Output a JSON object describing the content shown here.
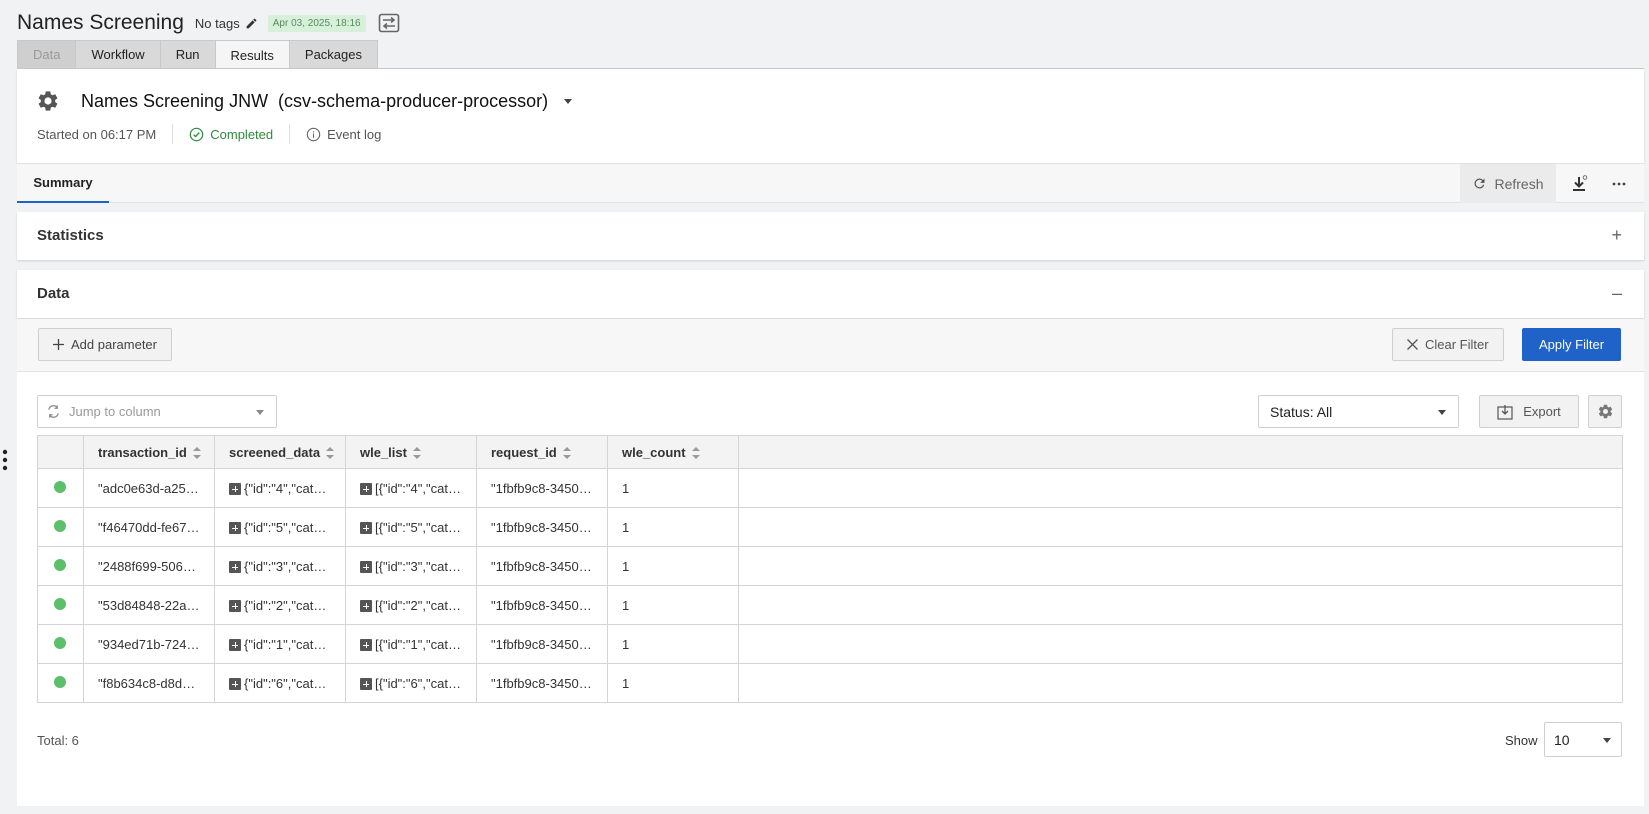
{
  "header": {
    "title": "Names Screening",
    "tags_label": "No tags",
    "date": "Apr 03, 2025, 18:16"
  },
  "tabs": [
    {
      "label": "Data"
    },
    {
      "label": "Workflow"
    },
    {
      "label": "Run"
    },
    {
      "label": "Results"
    },
    {
      "label": "Packages"
    }
  ],
  "job": {
    "title": "Names Screening JNW  (csv-schema-producer-processor)",
    "started": "Started on 06:17 PM",
    "status": "Completed",
    "event_log": "Event log"
  },
  "summary_bar": {
    "tab": "Summary",
    "refresh": "Refresh"
  },
  "sections": {
    "statistics": "Statistics",
    "statistics_toggle": "+",
    "data": "Data",
    "data_toggle": "–"
  },
  "filter": {
    "add_parameter": "Add parameter",
    "clear_filter": "Clear Filter",
    "apply_filter": "Apply Filter"
  },
  "toolbar": {
    "jump_placeholder": "Jump to column",
    "status_select": "Status: All",
    "export": "Export"
  },
  "table": {
    "columns": [
      "transaction_id",
      "screened_data",
      "wle_list",
      "request_id",
      "wle_count"
    ],
    "rows": [
      {
        "transaction_id": "\"adc0e63d-a25…",
        "screened_data": "{\"id\":\"4\",\"cat…",
        "wle_list": "[{\"id\":\"4\",\"cat…",
        "request_id": "\"1fbfb9c8-3450…",
        "wle_count": "1"
      },
      {
        "transaction_id": "\"f46470dd-fe67…",
        "screened_data": "{\"id\":\"5\",\"cat…",
        "wle_list": "[{\"id\":\"5\",\"cat…",
        "request_id": "\"1fbfb9c8-3450…",
        "wle_count": "1"
      },
      {
        "transaction_id": "\"2488f699-506…",
        "screened_data": "{\"id\":\"3\",\"cat…",
        "wle_list": "[{\"id\":\"3\",\"cat…",
        "request_id": "\"1fbfb9c8-3450…",
        "wle_count": "1"
      },
      {
        "transaction_id": "\"53d84848-22a…",
        "screened_data": "{\"id\":\"2\",\"cat…",
        "wle_list": "[{\"id\":\"2\",\"cat…",
        "request_id": "\"1fbfb9c8-3450…",
        "wle_count": "1"
      },
      {
        "transaction_id": "\"934ed71b-724…",
        "screened_data": "{\"id\":\"1\",\"cat…",
        "wle_list": "[{\"id\":\"1\",\"cat…",
        "request_id": "\"1fbfb9c8-3450…",
        "wle_count": "1"
      },
      {
        "transaction_id": "\"f8b634c8-d8d…",
        "screened_data": "{\"id\":\"6\",\"cat…",
        "wle_list": "[{\"id\":\"6\",\"cat…",
        "request_id": "\"1fbfb9c8-3450…",
        "wle_count": "1"
      }
    ]
  },
  "footer": {
    "total": "Total: 6",
    "show_label": "Show",
    "show_value": "10"
  },
  "colors": {
    "accent": "#1f62c8",
    "status_ok": "#5cbf6a",
    "completed_text": "#2e8b3d",
    "date_badge_bg": "#d7f0da"
  },
  "icons": {
    "pencil": "pencil-icon",
    "flow": "workflow-switch-icon",
    "settings": "gear-icon",
    "completed": "check-circle-icon",
    "info": "info-icon",
    "refresh": "refresh-icon",
    "download": "download-icon",
    "more": "more-horizontal-icon",
    "export": "export-icon",
    "expand": "plus-square-icon",
    "side_menu": "more-vertical-icon"
  }
}
